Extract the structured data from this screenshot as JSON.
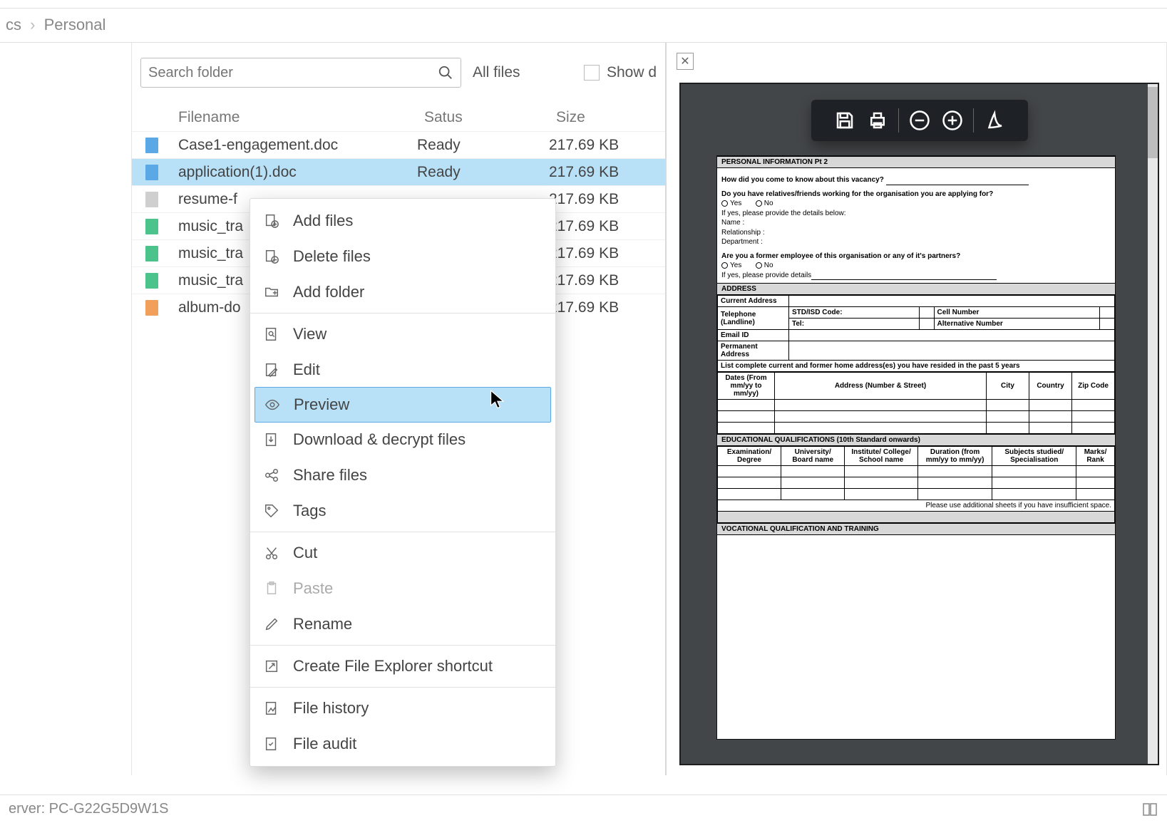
{
  "breadcrumb": {
    "prev": "cs",
    "current": "Personal"
  },
  "search": {
    "placeholder": "Search folder"
  },
  "filters": {
    "all_files": "All files",
    "show_d": "Show d"
  },
  "table": {
    "cols": {
      "filename": "Filename",
      "status": "Satus",
      "size": "Size"
    },
    "rows": [
      {
        "icon": "blue",
        "name": "Case1-engagement.doc",
        "status": "Ready",
        "size": "217.69 KB"
      },
      {
        "icon": "blue",
        "name": "application(1).doc",
        "status": "Ready",
        "size": "217.69 KB",
        "selected": true
      },
      {
        "icon": "gray",
        "name": "resume-f",
        "status": "",
        "size": "217.69 KB"
      },
      {
        "icon": "green",
        "name": "music_tra",
        "status": "",
        "size": "217.69 KB"
      },
      {
        "icon": "green",
        "name": "music_tra",
        "status": "",
        "size": "217.69 KB"
      },
      {
        "icon": "green",
        "name": "music_tra",
        "status": "",
        "size": "217.69 KB"
      },
      {
        "icon": "orange",
        "name": "album-do",
        "status": "",
        "size": "217.69 KB"
      }
    ]
  },
  "context_menu": {
    "add_files": "Add files",
    "delete_files": "Delete files",
    "add_folder": "Add folder",
    "view": "View",
    "edit": "Edit",
    "preview": "Preview",
    "download": "Download & decrypt files",
    "share": "Share files",
    "tags": "Tags",
    "cut": "Cut",
    "paste": "Paste",
    "rename": "Rename",
    "shortcut": "Create File Explorer shortcut",
    "history": "File history",
    "audit": "File audit"
  },
  "statusbar": {
    "left": "erver: PC-G22G5D9W1S"
  },
  "preview_doc": {
    "section1_title": "PERSONAL INFORMATION Pt 2",
    "q_vacancy": "How did you come to know about this vacancy?",
    "q_relatives": "Do you have relatives/friends working for the organisation you are applying for?",
    "yes": "Yes",
    "no": "No",
    "details_below": "If yes, please provide the details below:",
    "name": "Name :",
    "relationship": "Relationship :",
    "department": "Department :",
    "q_former": "Are you a former employee of this organisation or any of it's partners?",
    "details": "If yes, please provide details",
    "section2_title": "ADDRESS",
    "current_addr": "Current Address",
    "telephone": "Telephone (Landline)",
    "std": "STD/ISD Code:",
    "cell": "Cell Number",
    "tel": "Tel:",
    "alt": "Alternative Number",
    "email": "Email ID",
    "perm": "Permanent Address",
    "list_addr": "List complete current and former home address(es) you have resided in the past 5 years",
    "dates": "Dates (From mm/yy to mm/yy)",
    "addr": "Address (Number & Street)",
    "city": "City",
    "country": "Country",
    "zip": "Zip Code",
    "section3_title": "EDUCATIONAL QUALIFICATIONS (10th Standard onwards)",
    "exam": "Examination/ Degree",
    "univ": "University/ Board name",
    "inst": "Institute/ College/ School name",
    "dur": "Duration (from mm/yy to mm/yy)",
    "subj": "Subjects studied/ Specialisation",
    "marks": "Marks/ Rank",
    "additional": "Please use additional sheets if you have insufficient space.",
    "section4_title": "VOCATIONAL QUALIFICATION AND TRAINING"
  }
}
